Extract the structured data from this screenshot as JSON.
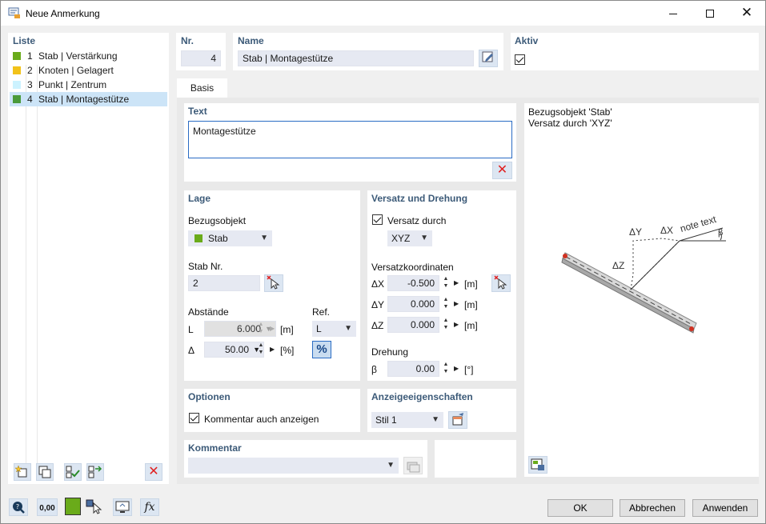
{
  "window": {
    "title": "Neue Anmerkung"
  },
  "list": {
    "header": "Liste",
    "items": [
      {
        "num": "1",
        "label": "Stab | Verstärkung",
        "color": "#6aab1a"
      },
      {
        "num": "2",
        "label": "Knoten | Gelagert",
        "color": "#f2c21a"
      },
      {
        "num": "3",
        "label": "Punkt | Zentrum",
        "color": "#ccf2ff"
      },
      {
        "num": "4",
        "label": "Stab | Montagestütze",
        "color": "#4a9a3a"
      }
    ]
  },
  "header_fields": {
    "nr_label": "Nr.",
    "nr_value": "4",
    "name_label": "Name",
    "name_value": "Stab | Montagestütze",
    "aktiv_label": "Aktiv"
  },
  "tabs": [
    {
      "label": "Basis"
    }
  ],
  "text_section": {
    "header": "Text",
    "value": "Montagestütze"
  },
  "lage": {
    "header": "Lage",
    "bezugsobjekt_label": "Bezugsobjekt",
    "bezugsobjekt_value": "Stab",
    "bezugsobjekt_color": "#6aab1a",
    "stab_nr_label": "Stab Nr.",
    "stab_nr_value": "2",
    "abstaende_label": "Abstände",
    "ref_label": "Ref.",
    "L_label": "L",
    "L_value": "6.000",
    "L_unit": "[m]",
    "delta_label": "Δ",
    "delta_value": "50.00",
    "delta_unit": "[%]",
    "ref_value": "L",
    "percent_button": "%"
  },
  "versatz": {
    "header": "Versatz und Drehung",
    "versatz_durch_label": "Versatz durch",
    "versatz_durch_value": "XYZ",
    "koord_label": "Versatzkoordinaten",
    "dx_label": "ΔX",
    "dx_value": "-0.500",
    "dx_unit": "[m]",
    "dy_label": "ΔY",
    "dy_value": "0.000",
    "dy_unit": "[m]",
    "dz_label": "ΔZ",
    "dz_value": "0.000",
    "dz_unit": "[m]",
    "drehung_label": "Drehung",
    "beta_label": "β",
    "beta_value": "0.00",
    "beta_unit": "[°]"
  },
  "optionen": {
    "header": "Optionen",
    "kommentar_anzeigen": "Kommentar auch anzeigen"
  },
  "anzeige": {
    "header": "Anzeigeeigenschaften",
    "stil_value": "Stil 1"
  },
  "kommentar": {
    "header": "Kommentar",
    "value": ""
  },
  "preview": {
    "line1": "Bezugsobjekt 'Stab'",
    "line2": "Versatz durch 'XYZ'",
    "dy": "ΔY",
    "dx": "ΔX",
    "dz": "ΔZ",
    "note": "note text",
    "beta": "β"
  },
  "footer": {
    "ok": "OK",
    "abbrechen": "Abbrechen",
    "anwenden": "Anwenden",
    "unit_icon_text": "0,00"
  }
}
